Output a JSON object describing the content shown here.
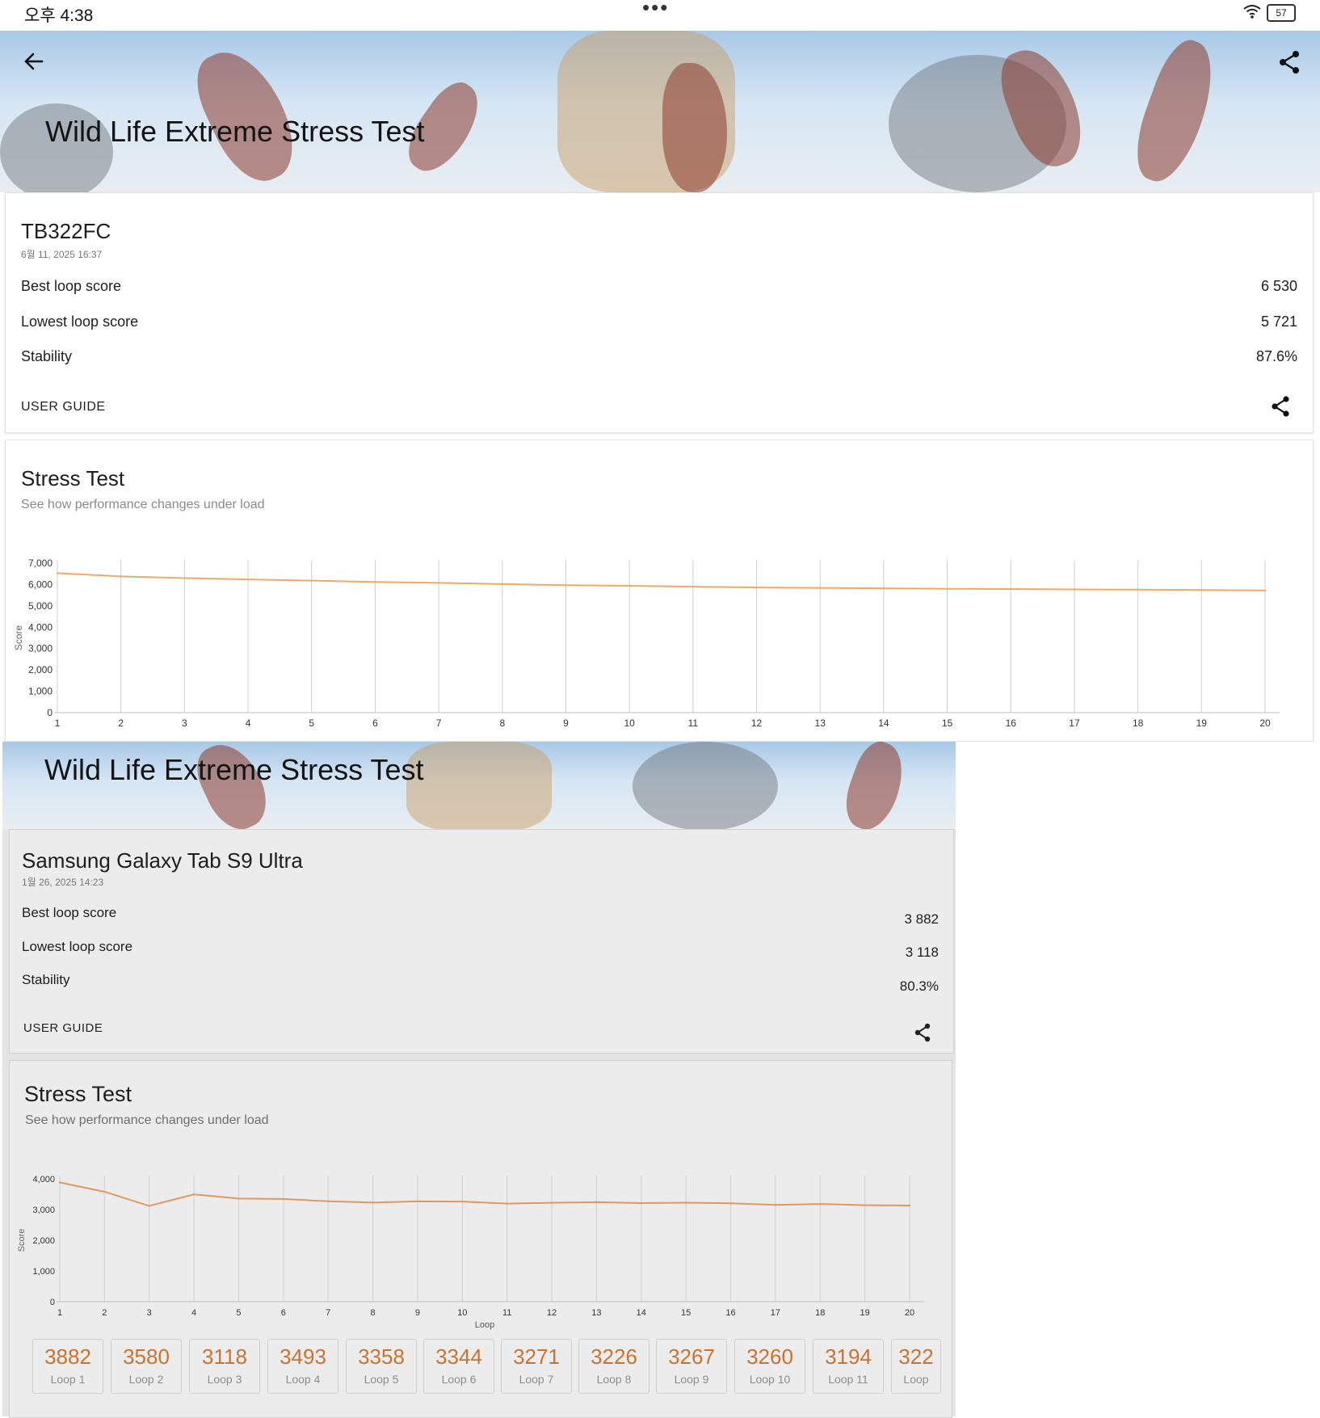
{
  "status_bar": {
    "time": "오후 4:38",
    "more": "•••",
    "battery": "57"
  },
  "top": {
    "banner_title": "Wild Life Extreme Stress Test",
    "device": "TB322FC",
    "date": "6월 11, 2025 16:37",
    "rows": [
      {
        "label": "Best loop score",
        "value": "6 530"
      },
      {
        "label": "Lowest loop score",
        "value": "5 721"
      },
      {
        "label": "Stability",
        "value": "87.6%"
      }
    ],
    "user_guide": "USER GUIDE",
    "section_title": "Stress Test",
    "section_sub": "See how performance changes under load"
  },
  "bottom": {
    "banner_title": "Wild Life Extreme Stress Test",
    "device": "Samsung Galaxy Tab S9 Ultra",
    "date": "1월 26, 2025 14:23",
    "rows": [
      {
        "label": "Best loop score",
        "value": "3 882"
      },
      {
        "label": "Lowest loop score",
        "value": "3 118"
      },
      {
        "label": "Stability",
        "value": "80.3%"
      }
    ],
    "user_guide": "USER GUIDE",
    "section_title": "Stress Test",
    "section_sub": "See how performance changes under load",
    "loop_tiles": [
      {
        "value": "3882",
        "label": "Loop 1"
      },
      {
        "value": "3580",
        "label": "Loop 2"
      },
      {
        "value": "3118",
        "label": "Loop 3"
      },
      {
        "value": "3493",
        "label": "Loop 4"
      },
      {
        "value": "3358",
        "label": "Loop 5"
      },
      {
        "value": "3344",
        "label": "Loop 6"
      },
      {
        "value": "3271",
        "label": "Loop 7"
      },
      {
        "value": "3226",
        "label": "Loop 8"
      },
      {
        "value": "3267",
        "label": "Loop 9"
      },
      {
        "value": "3260",
        "label": "Loop 10"
      },
      {
        "value": "3194",
        "label": "Loop 11"
      },
      {
        "value": "322",
        "label": "Loop"
      }
    ]
  },
  "chart_data": [
    {
      "type": "line",
      "ylabel": "Score",
      "xlabel": "",
      "ylim": [
        0,
        7000
      ],
      "yticks": [
        "0",
        "1,000",
        "2,000",
        "3,000",
        "4,000",
        "5,000",
        "6,000",
        "7,000"
      ],
      "x": [
        1,
        2,
        3,
        4,
        5,
        6,
        7,
        8,
        9,
        10,
        11,
        12,
        13,
        14,
        15,
        16,
        17,
        18,
        19,
        20
      ],
      "series": [
        {
          "values": [
            6530,
            6380,
            6300,
            6240,
            6180,
            6120,
            6080,
            6020,
            5970,
            5940,
            5900,
            5860,
            5840,
            5820,
            5800,
            5790,
            5770,
            5760,
            5740,
            5721
          ]
        }
      ],
      "grid": "vertical",
      "line_color": "#f0a868"
    },
    {
      "type": "line",
      "ylabel": "Score",
      "xlabel": "Loop",
      "ylim": [
        0,
        4000
      ],
      "yticks": [
        "0",
        "1,000",
        "2,000",
        "3,000",
        "4,000"
      ],
      "x": [
        1,
        2,
        3,
        4,
        5,
        6,
        7,
        8,
        9,
        10,
        11,
        12,
        13,
        14,
        15,
        16,
        17,
        18,
        19,
        20
      ],
      "series": [
        {
          "values": [
            3882,
            3580,
            3118,
            3493,
            3358,
            3344,
            3271,
            3226,
            3267,
            3260,
            3194,
            3220,
            3240,
            3210,
            3225,
            3205,
            3150,
            3180,
            3140,
            3130
          ]
        }
      ],
      "grid": "vertical",
      "line_color": "#e09a60"
    }
  ]
}
